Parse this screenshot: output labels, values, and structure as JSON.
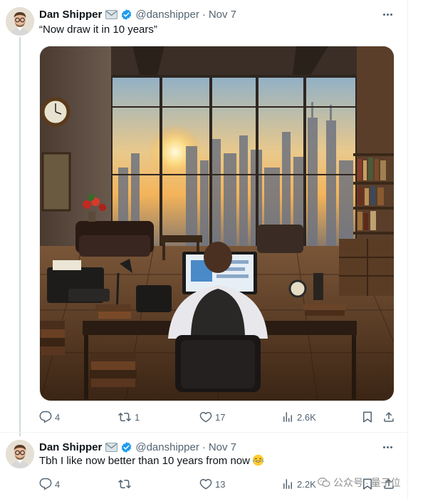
{
  "tweets": [
    {
      "author": "Dan Shipper",
      "handle": "@danshipper",
      "date": "Nov 7",
      "text": "“Now draw it in 10 years”",
      "image": "office-with-city-skyline",
      "stats": {
        "replies": "4",
        "reposts": "1",
        "likes": "17",
        "views": "2.6K"
      }
    },
    {
      "author": "Dan Shipper",
      "handle": "@danshipper",
      "date": "Nov 7",
      "text": "Tbh I like now better than 10 years from now",
      "emoji": "tears-of-joy-emoji",
      "stats": {
        "replies": "4",
        "reposts": "",
        "likes": "13",
        "views": "2.2K"
      }
    }
  ],
  "separator": "·",
  "watermark": {
    "left": "公众号",
    "right": "量子位"
  },
  "colors": {
    "text": "#0f1419",
    "secondary": "#536471",
    "verified": "#1d9bf0",
    "divider": "#eff3f4"
  },
  "icons": [
    "mail-icon",
    "verified-badge-icon",
    "more-icon",
    "reply-icon",
    "repost-icon",
    "like-icon",
    "views-icon",
    "bookmark-icon",
    "share-icon"
  ]
}
